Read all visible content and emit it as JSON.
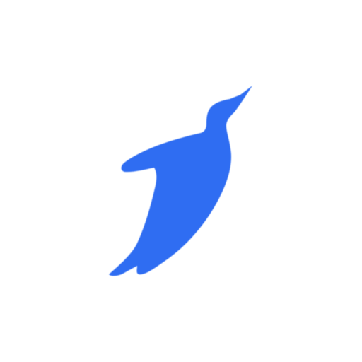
{
  "icon": {
    "name": "penguin-icon",
    "color": "#2f6df2"
  },
  "background_color": "#ffffff"
}
